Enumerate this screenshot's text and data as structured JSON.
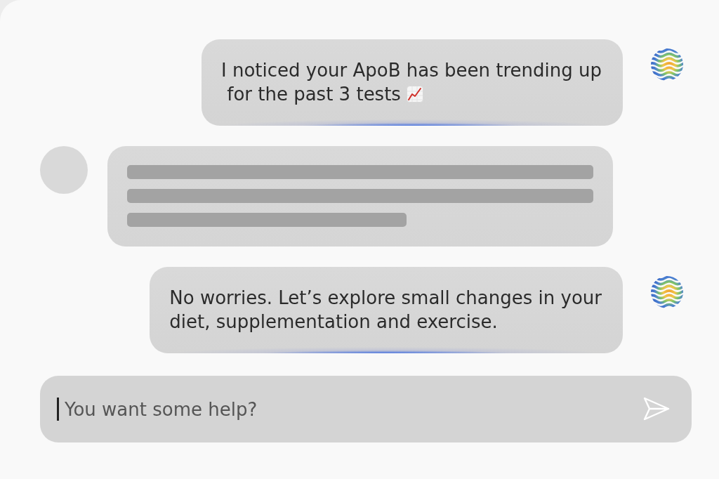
{
  "messages": [
    {
      "kind": "assistant",
      "text": "I noticed your ApoB has been trending up\n for the past 3 tests",
      "trend_icon": true
    },
    {
      "kind": "placeholder"
    },
    {
      "kind": "assistant",
      "text": "No worries. Let’s explore small changes in your\ndiet, supplementation and exercise.",
      "trend_icon": false
    }
  ],
  "composer": {
    "placeholder": "You want some help?",
    "focused": true
  }
}
